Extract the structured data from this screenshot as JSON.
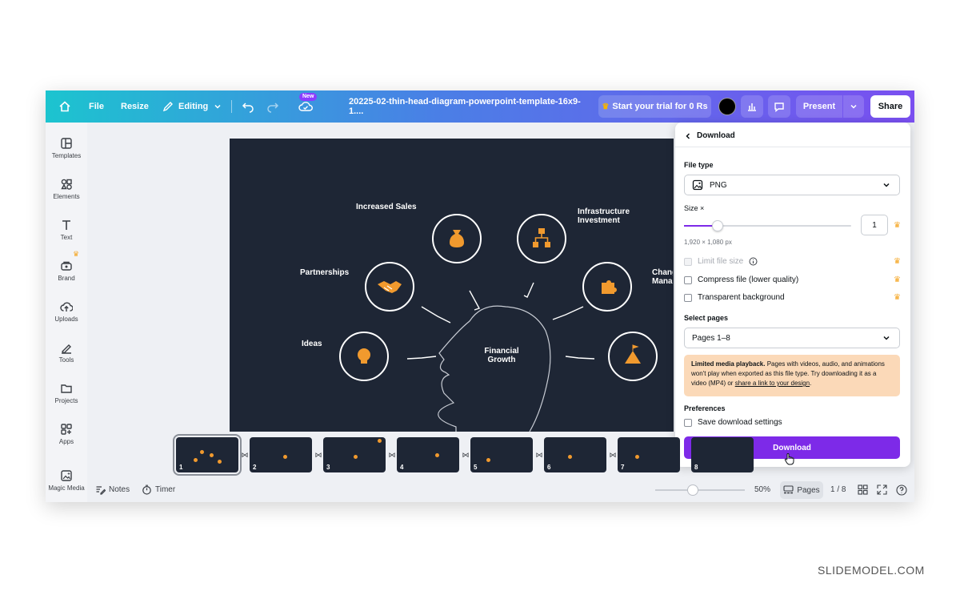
{
  "topbar": {
    "file": "File",
    "resize": "Resize",
    "editing": "Editing",
    "new_badge": "New",
    "doc_title": "20225-02-thin-head-diagram-powerpoint-template-16x9-1....",
    "trial": "Start your trial for 0 Rs",
    "present": "Present",
    "share": "Share",
    "color_swatch": "#000000"
  },
  "sidebar": {
    "items": [
      {
        "label": "Templates",
        "icon": "templates-icon"
      },
      {
        "label": "Elements",
        "icon": "elements-icon"
      },
      {
        "label": "Text",
        "icon": "text-icon"
      },
      {
        "label": "Brand",
        "icon": "brand-icon"
      },
      {
        "label": "Uploads",
        "icon": "uploads-icon"
      },
      {
        "label": "Tools",
        "icon": "tools-icon"
      },
      {
        "label": "Projects",
        "icon": "projects-icon"
      },
      {
        "label": "Apps",
        "icon": "apps-icon"
      },
      {
        "label": "Magic Media",
        "icon": "magic-media-icon"
      }
    ]
  },
  "slide": {
    "center": "Financial Growth",
    "labels": {
      "increased_sales": "Increased Sales",
      "infrastructure": "Infrastructure Investment",
      "partnerships": "Partnerships",
      "ideas": "Ideas",
      "change": "Chang Manag"
    }
  },
  "download_panel": {
    "title": "Download",
    "file_type_label": "File type",
    "file_type_value": "PNG",
    "size_label": "Size ×",
    "size_value": "1",
    "size_fraction": 0.2,
    "dimensions": "1,920 × 1,080 px",
    "options": [
      {
        "label": "Limit file size",
        "disabled": true
      },
      {
        "label": "Compress file (lower quality)",
        "disabled": false
      },
      {
        "label": "Transparent background",
        "disabled": false
      }
    ],
    "select_pages_label": "Select pages",
    "pages_value": "Pages 1–8",
    "notice_bold": "Limited media playback.",
    "notice_text": " Pages with videos, audio, and animations won't play when exported as this file type. Try downloading it as a video (MP4) or ",
    "notice_link": "share a link to your design",
    "notice_end": ".",
    "preferences_label": "Preferences",
    "save_settings": "Save download settings",
    "download_button": "Download",
    "accent": "#7d2ae8",
    "notice_bg": "#fbd9b8"
  },
  "thumbnails": [
    "1",
    "2",
    "3",
    "4",
    "5",
    "6",
    "7",
    "8"
  ],
  "bottombar": {
    "notes": "Notes",
    "timer": "Timer",
    "zoom": "50%",
    "zoom_fraction": 0.42,
    "pages": "Pages",
    "page_count": "1 / 8"
  },
  "watermark": "SLIDEMODEL.COM"
}
